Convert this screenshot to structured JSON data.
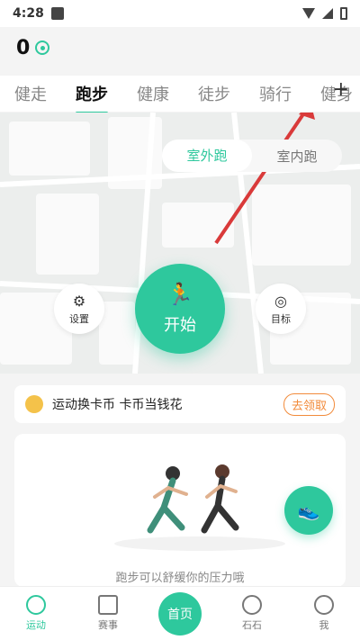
{
  "status_bar": {
    "time": "4:28"
  },
  "points": {
    "value": "0"
  },
  "tabs": [
    {
      "label": "健走"
    },
    {
      "label": "跑步"
    },
    {
      "label": "健康"
    },
    {
      "label": "徒步"
    },
    {
      "label": "骑行"
    },
    {
      "label": "健身"
    }
  ],
  "tab_add_symbol": "+",
  "run_mode": {
    "outdoor_label": "室外跑",
    "indoor_label": "室内跑"
  },
  "start": {
    "label": "开始"
  },
  "settings": {
    "label": "设置"
  },
  "goal": {
    "label": "目标"
  },
  "banner": {
    "text": "运动换卡币 卡币当钱花",
    "action_label": "去领取"
  },
  "card": {
    "caption": "跑步可以舒缓你的压力哦"
  },
  "bottom_nav": {
    "items": [
      {
        "label": "运动"
      },
      {
        "label": "赛事"
      },
      {
        "label": "首页"
      },
      {
        "label": "石石"
      },
      {
        "label": "我"
      }
    ]
  },
  "colors": {
    "accent": "#2ec89d",
    "banner_btn": "#f28b3b"
  }
}
